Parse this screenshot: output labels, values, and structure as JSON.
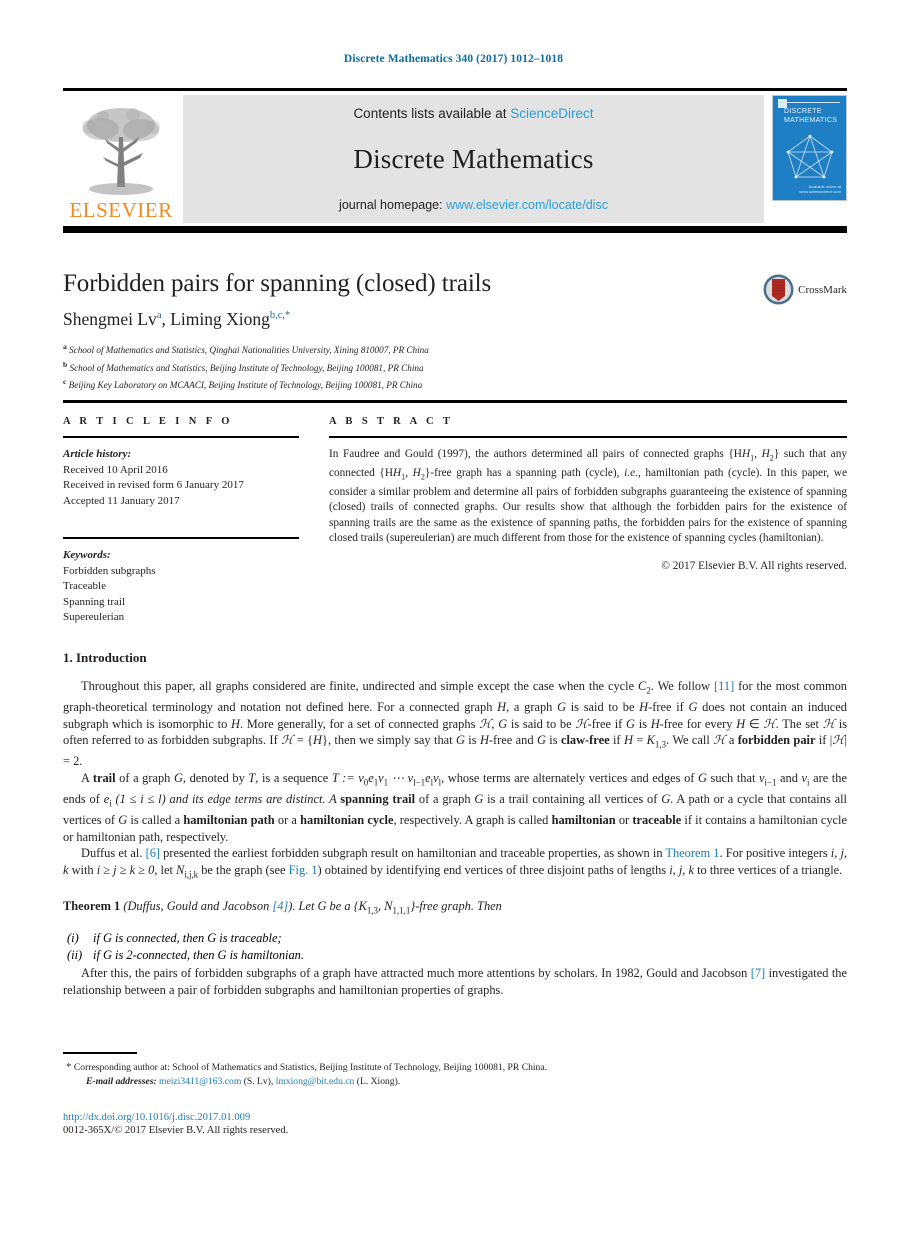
{
  "running_head": "Discrete Mathematics 340 (2017) 1012–1018",
  "masthead": {
    "contents_prefix": "Contents lists available at ",
    "contents_link": "ScienceDirect",
    "journal_title": "Discrete Mathematics",
    "homepage_prefix": "journal homepage: ",
    "homepage_link": "www.elsevier.com/locate/disc",
    "publisher": "ELSEVIER",
    "cover_name_line1": "DISCRETE",
    "cover_name_line2": "MATHEMATICS",
    "cover_footer": "Available online at www.sciencedirect.com"
  },
  "article": {
    "title": "Forbidden pairs for spanning (closed) trails",
    "authors_part1": "Shengmei Lv",
    "authors_sup1": "a",
    "authors_part2": ", Liming Xiong",
    "authors_sup2": "b,c,*",
    "affiliations": [
      {
        "label": "a",
        "text": "School of Mathematics and Statistics, Qinghai Nationalities University, Xining 810007, PR China"
      },
      {
        "label": "b",
        "text": "School of Mathematics and Statistics, Beijing Institute of Technology, Beijing 100081, PR China"
      },
      {
        "label": "c",
        "text": "Beijing Key Laboratory on MCAACI, Beijing Institute of Technology, Beijing 100081, PR China"
      }
    ],
    "crossmark_label": "CrossMark"
  },
  "info": {
    "heading": "A R T I C L E    I N F O",
    "history_label": "Article history:",
    "history": [
      "Received 10 April 2016",
      "Received in revised form 6 January 2017",
      "Accepted 11 January 2017"
    ],
    "keywords_label": "Keywords:",
    "keywords": [
      "Forbidden subgraphs",
      "Traceable",
      "Spanning trail",
      "Supereulerian"
    ]
  },
  "abstract": {
    "heading": "A B S T R A C T",
    "p1_a": "In Faudree and Gould (1997), the authors determined all pairs of connected graphs {H",
    "p1_b": "such that any connected {H",
    "p1_c": "-free graph has a spanning path (cycle), ",
    "p1_ie": "i.e.",
    "p1_d": ", hamiltonian path (cycle). In this paper, we consider a similar problem and determine all pairs of forbidden subgraphs guaranteeing the existence of spanning (closed) trails of connected graphs. Our results show that although the forbidden pairs for the existence of spanning trails are the same as the existence of spanning paths, the forbidden pairs for the existence of spanning closed trails (supereulerian) are much different from those for the existence of spanning cycles (hamiltonian).",
    "copyright": "© 2017 Elsevier B.V. All rights reserved."
  },
  "body": {
    "section_heading": "1. Introduction",
    "p1_t1": "Throughout  this paper, all graphs considered are finite, undirected and simple except the case when the cycle ",
    "p1_c2": "C",
    "p1_c2sub": "2",
    "p1_t2": ". We follow ",
    "p1_ref11": "[11]",
    "p1_t3": " for the most common graph-theoretical terminology and notation not defined here. For a connected graph ",
    "p1_H": "H",
    "p1_t4": ", a graph ",
    "p1_G": "G",
    "p1_t5": " is said to be ",
    "p1_Hfree": "H",
    "p1_t6": "-free if ",
    "p1_t7": " does not contain an induced subgraph which is isomorphic to ",
    "p1_t8": ". More generally, for a set of connected graphs ",
    "p1_Hcal": "ℋ",
    "p1_t9": ", ",
    "p1_t10": " is said to be ",
    "p1_t11": "-free if ",
    "p1_t12": " is ",
    "p1_t13": "-free for every ",
    "p1_in": " ∈ ",
    "p1_t14": ". The set ",
    "p1_t15": " is often referred to as forbidden subgraphs. If ",
    "p1_t16": " = {",
    "p1_t17": "}, then we simply say that ",
    "p1_t18": " is ",
    "p1_t19": "-free and ",
    "p1_t20": " is ",
    "p1_clawfree": "claw-free",
    "p1_t21": " if ",
    "p1_t22": " = ",
    "p1_K13": "K",
    "p1_K13sub": "1,3",
    "p1_t23": ". We call ",
    "p1_t24": " a ",
    "p1_fp": "forbidden pair",
    "p1_t25": " if |",
    "p1_t26": "| = 2.",
    "p2_a": "A ",
    "p2_trail": "trail",
    "p2_b": " of a graph ",
    "p2_c": ", denoted by ",
    "p2_d": ", is a sequence ",
    "p2_seq": "T := v",
    "p2_e": ", whose terms are alternately vertices and edges of ",
    "p2_f": " such that ",
    "p2_g": " and ",
    "p2_h": " are the ends of ",
    "p2_i": " (1 ≤ i ≤ l) and its edge terms are distinct. A ",
    "p2_st": "spanning trail",
    "p2_j": " of a graph ",
    "p2_k": " is a trail containing all vertices of ",
    "p2_l": ". A path or a cycle that contains all vertices of ",
    "p2_m": " is called a ",
    "p2_hp": "hamiltonian path",
    "p2_n": " or a ",
    "p2_hc": "hamiltonian cycle",
    "p2_o": ", respectively. A graph is called ",
    "p2_ham": "hamiltonian",
    "p2_p": " or ",
    "p2_tr": "traceable",
    "p2_q": " if it contains a hamiltonian cycle or hamiltonian path, respectively.",
    "p3_a": "Duffus et al. ",
    "p3_ref6": "[6]",
    "p3_b": " presented the earliest forbidden subgraph result on hamiltonian and traceable properties, as shown in ",
    "p3_thmlink": "Theorem 1",
    "p3_c": ". For positive integers ",
    "p3_ijk": "i, j, k",
    "p3_d": " with ",
    "p3_ineq": "i ≥ j ≥ k ≥ 0",
    "p3_e": ", let ",
    "p3_N": "N",
    "p3_Nsub": "i,j,k",
    "p3_f": " be the graph (see ",
    "p3_figlink": "Fig. 1",
    "p3_g": ") obtained by identifying end vertices of three disjoint paths of lengths ",
    "p3_h": " to three vertices of a triangle.",
    "theorem_label": "Theorem 1",
    "theorem_attr": " (Duffus, Gould and Jacobson ",
    "theorem_ref": "[4]",
    "theorem_attr2": "). ",
    "theorem_stmt_a": "Let G be a {K",
    "theorem_stmt_sub1": "1,3",
    "theorem_stmt_b": ", N",
    "theorem_stmt_sub2": "1,1,1",
    "theorem_stmt_c": "}-free graph. Then",
    "theorem_items": [
      {
        "num": "(i)",
        "text": "if G is connected, then G is traceable;"
      },
      {
        "num": "(ii)",
        "text": "if G is 2-connected, then G is hamiltonian."
      }
    ],
    "p4_a": "After this, the pairs of forbidden subgraphs of a graph have attracted much more attentions by scholars. In 1982, Gould and Jacobson ",
    "p4_ref7": "[7]",
    "p4_b": " investigated the relationship between a pair of forbidden subgraphs and hamiltonian properties of graphs."
  },
  "footer": {
    "star": "*",
    "corresponding": "Corresponding author at: School of Mathematics and Statistics, Beijing Institute of Technology, Beijing 100081, PR China.",
    "email_label": "E-mail addresses:",
    "email1": "meizi3411@163.com",
    "email1_name": " (S. Lv), ",
    "email2": "lmxiong@bit.edu.cn",
    "email2_name": " (L. Xiong).",
    "doi": "http://dx.doi.org/10.1016/j.disc.2017.01.009",
    "issn": "0012-365X/© 2017 Elsevier B.V. All rights reserved."
  },
  "colors": {
    "link": "#2a9fd6",
    "ref": "#1a7db5",
    "runhead": "#0c6ca0",
    "elsevier_orange": "#f08a22",
    "cover_blue": "#1f7fc4"
  }
}
